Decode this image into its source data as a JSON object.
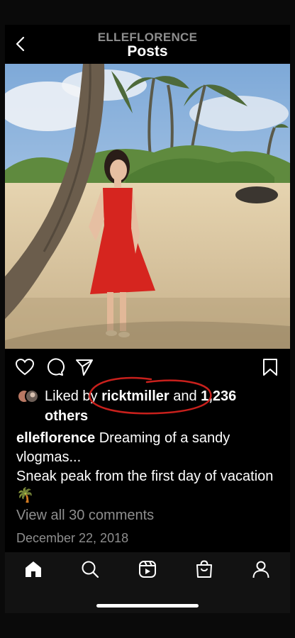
{
  "header": {
    "username": "ELLEFLORENCE",
    "title": "Posts"
  },
  "post": {
    "liked_prefix": "Liked by ",
    "liked_user": "ricktmiller",
    "liked_mid": " and ",
    "liked_count": "1,236",
    "liked_suffix": "others",
    "caption_user": "elleflorence",
    "caption_line1": " Dreaming of a sandy vlogmas...",
    "caption_line2": "Sneak peak from the first day of vacation 🌴",
    "view_comments": "View all 30 comments",
    "date": "December 22, 2018"
  },
  "icons": {
    "back": "chevron-left-icon",
    "like": "heart-icon",
    "comment": "comment-bubble-icon",
    "share": "paper-plane-icon",
    "save": "bookmark-icon",
    "home": "home-icon",
    "search": "search-icon",
    "reels": "reels-icon",
    "shop": "shopping-bag-icon",
    "profile": "profile-icon"
  },
  "colors": {
    "background": "#000000",
    "muted_text": "#8e8e8e",
    "annotation_circle": "#c8201c"
  }
}
